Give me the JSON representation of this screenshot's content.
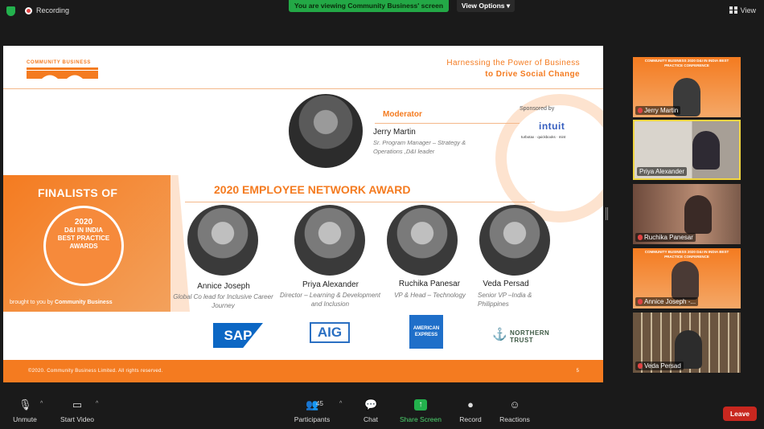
{
  "topbar": {
    "recording_label": "Recording",
    "viewing_banner": "You are viewing Community Business' screen",
    "view_options_label": "View Options",
    "view_label": "View"
  },
  "slide": {
    "logo_text": "COMMUNITY BUSINESS",
    "tagline_line1": "Harnessing the Power of Business",
    "tagline_line2": "to Drive Social Change",
    "moderator_heading": "Moderator",
    "moderator_name": "Jerry Martin",
    "moderator_role": "Sr. Program Manager – Strategy & Operations ,D&I leader",
    "sponsored_label": "Sponsored by",
    "sponsor_name": "intuit",
    "sponsor_sub": "turbotax · quickbooks · mint",
    "finalists_of": "FINALISTS OF",
    "badge": {
      "year": "2020",
      "line1": "D&I IN INDIA",
      "line2": "BEST PRACTICE",
      "line3": "AWARDS"
    },
    "brought_by_prefix": "brought to you by",
    "brought_by_name": "Community Business",
    "award_title": "2020 EMPLOYEE NETWORK AWARD",
    "finalists": [
      {
        "name": "Annice Joseph",
        "role": "Global Co lead for Inclusive Career Journey"
      },
      {
        "name": "Priya Alexander",
        "role": "Director – Learning & Development and Inclusion"
      },
      {
        "name": "Ruchika Panesar",
        "role": "VP & Head – Technology"
      },
      {
        "name": "Veda Persad",
        "role": "Senior VP –India & Philippines"
      }
    ],
    "logos": {
      "sap": "SAP",
      "aig": "AIG",
      "amex_line1": "AMERICAN",
      "amex_line2": "EXPRESS",
      "ntrust_line1": "NORTHERN",
      "ntrust_line2": "TRUST"
    },
    "footer_text": "©2020. Community Business Limited. All rights reserved.",
    "page_number": "5"
  },
  "participants": [
    {
      "name": "Jerry Martin",
      "banner": "COMMUNITY BUSINESS 2020 D&I IN INDIA BEST PRACTICE CONFERENCE"
    },
    {
      "name": "Priya Alexander"
    },
    {
      "name": "Ruchika Panesar"
    },
    {
      "name": "Annice Joseph -...",
      "banner": "COMMUNITY BUSINESS 2020 D&I IN INDIA BEST PRACTICE CONFERENCE"
    },
    {
      "name": "Veda Persad"
    }
  ],
  "toolbar": {
    "unmute": "Unmute",
    "start_video": "Start Video",
    "participants": "Participants",
    "participant_count": "45",
    "chat": "Chat",
    "share_screen": "Share Screen",
    "record": "Record",
    "reactions": "Reactions",
    "leave": "Leave"
  }
}
